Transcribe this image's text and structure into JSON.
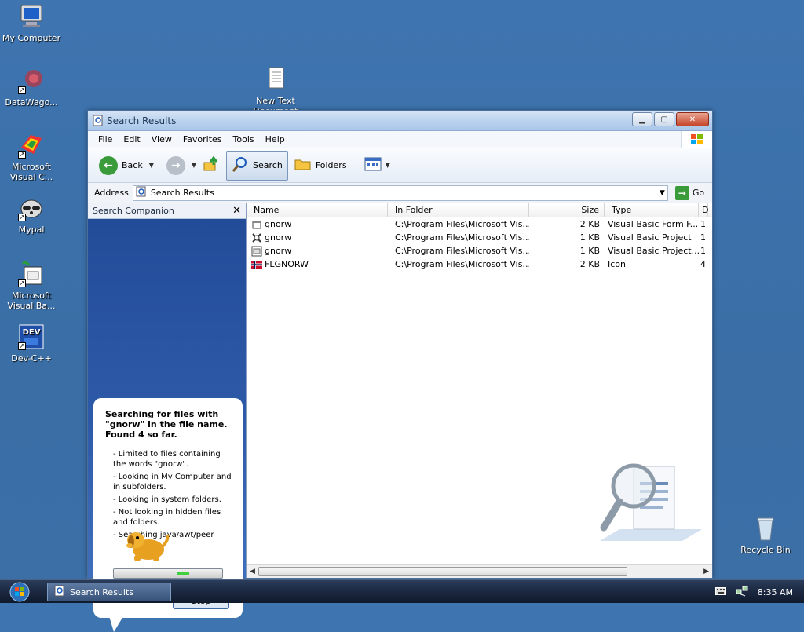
{
  "desktop": {
    "icons": [
      {
        "label": "My Computer"
      },
      {
        "label": "DataWago..."
      },
      {
        "label": "Microsoft Visual C..."
      },
      {
        "label": "Mypal"
      },
      {
        "label": "Microsoft Visual Ba..."
      },
      {
        "label": "Dev-C++"
      },
      {
        "label": "New Text Document"
      },
      {
        "label": "Recycle Bin"
      }
    ]
  },
  "window": {
    "title": "Search Results",
    "menu": [
      "File",
      "Edit",
      "View",
      "Favorites",
      "Tools",
      "Help"
    ],
    "toolbar": {
      "back": "Back",
      "search": "Search",
      "folders": "Folders"
    },
    "address": {
      "label": "Address",
      "value": "Search Results",
      "go": "Go"
    },
    "companion": {
      "title": "Search Companion",
      "heading": "Searching for files with \"gnorw\" in the file name. Found 4 so far.",
      "items": [
        "- Limited to files containing the words \"gnorw\".",
        "- Looking in My Computer and in subfolders.",
        "- Looking in system folders.",
        "- Not looking in hidden files and folders.",
        "- Searching java/awt/peer"
      ],
      "stop": "Stop"
    },
    "columns": [
      "Name",
      "In Folder",
      "Size",
      "Type",
      "D"
    ],
    "rows": [
      {
        "name": "gnorw",
        "folder": "C:\\Program Files\\Microsoft Vis...",
        "size": "2 KB",
        "type": "Visual Basic Form F...",
        "extra": "1",
        "icon": "form-file-icon"
      },
      {
        "name": "gnorw",
        "folder": "C:\\Program Files\\Microsoft Vis...",
        "size": "1 KB",
        "type": "Visual Basic Project",
        "extra": "1",
        "icon": "vb-project-icon"
      },
      {
        "name": "gnorw",
        "folder": "C:\\Program Files\\Microsoft Vis...",
        "size": "1 KB",
        "type": "Visual Basic Project...",
        "extra": "1",
        "icon": "vb-workspace-icon"
      },
      {
        "name": "FLGNORW",
        "folder": "C:\\Program Files\\Microsoft Vis...",
        "size": "2 KB",
        "type": "Icon",
        "extra": "4",
        "icon": "norway-flag-icon"
      }
    ]
  },
  "taskbar": {
    "task": "Search Results",
    "clock": "8:35 AM"
  },
  "colors": {
    "desktop": "#3a6ea5",
    "companion": "#2c56a1"
  }
}
